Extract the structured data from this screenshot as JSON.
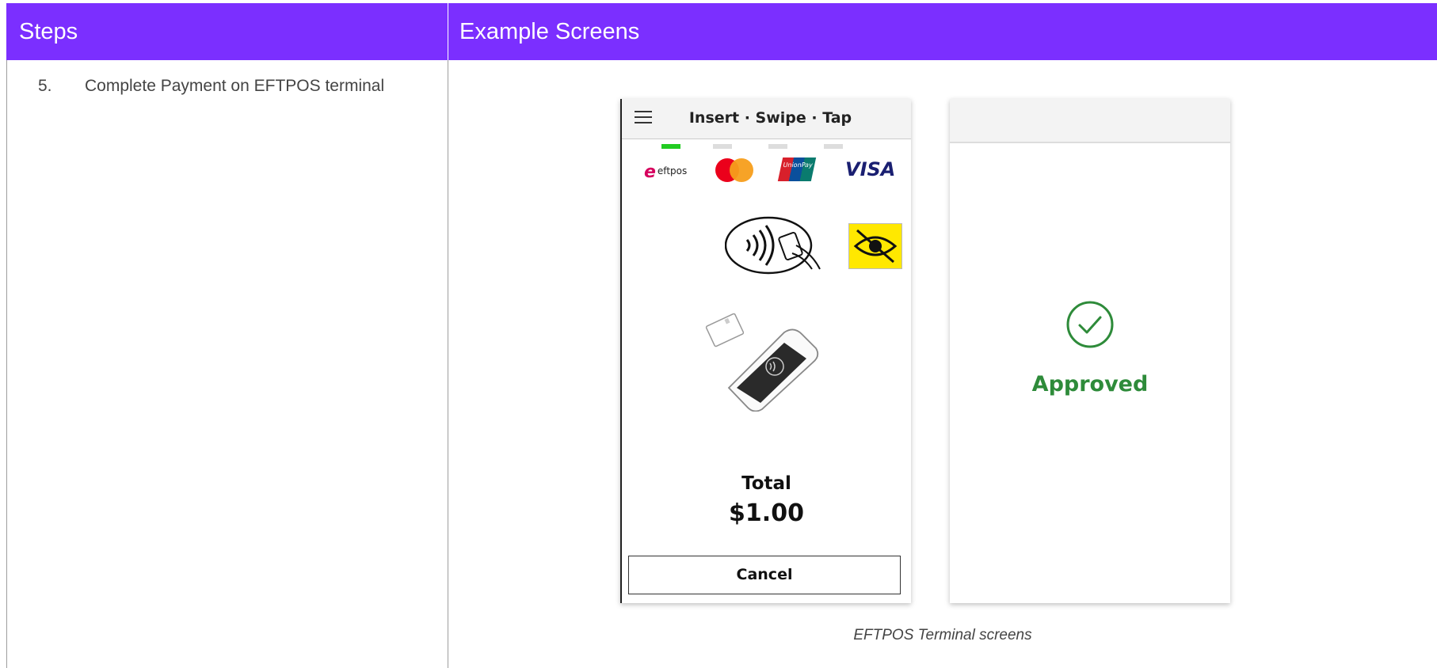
{
  "headers": {
    "steps": "Steps",
    "example_screens": "Example Screens"
  },
  "step": {
    "number": "5.",
    "text": "Complete Payment on EFTPOS terminal"
  },
  "terminal1": {
    "title": "Insert · Swipe · Tap",
    "card_brands": [
      "eftpos",
      "mastercard",
      "unionpay",
      "visa"
    ],
    "eftpos_label": "eftpos",
    "unionpay_label": "UnionPay",
    "visa_label": "VISA",
    "total_label": "Total",
    "total_amount": "$1.00",
    "cancel_label": "Cancel",
    "indicator_active_color": "#22cc22",
    "indicator_inactive_color": "#dddddd"
  },
  "terminal2": {
    "status": "Approved",
    "status_color": "#2e8b3a"
  },
  "caption": "EFTPOS Terminal screens",
  "colors": {
    "header_bg": "#7b2fff",
    "header_text": "#ffffff"
  }
}
